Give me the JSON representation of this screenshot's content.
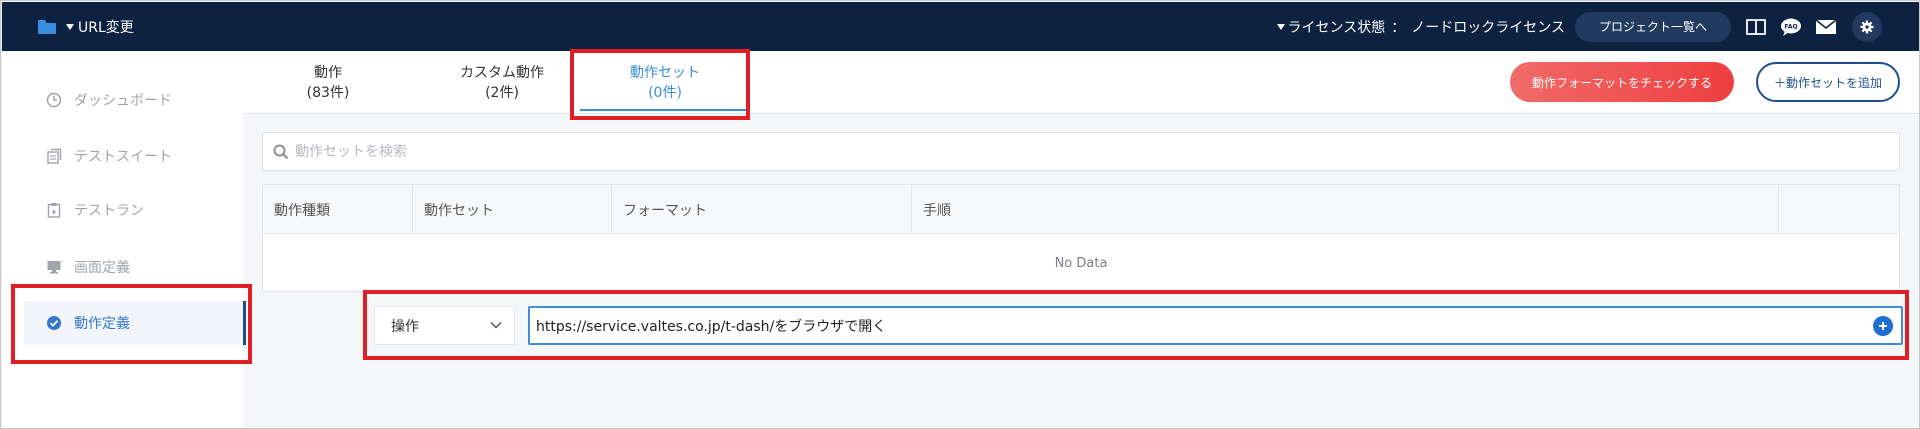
{
  "header": {
    "project_name": "URL変更",
    "license_label": "ライセンス状態",
    "license_sep": "：",
    "license_value": "ノードロックライセンス",
    "project_list_button": "プロジェクト一覧へ",
    "icons": [
      "book-icon",
      "faq-chat-icon",
      "mail-icon",
      "gear-icon"
    ]
  },
  "sidebar": {
    "items": [
      {
        "label": "ダッシュボード",
        "icon": "dashboard-clock-icon"
      },
      {
        "label": "テストスイート",
        "icon": "test-suite-icon"
      },
      {
        "label": "テストラン",
        "icon": "test-run-icon"
      },
      {
        "label": "画面定義",
        "icon": "monitor-icon"
      },
      {
        "label": "動作定義",
        "icon": "check-circle-icon",
        "active": true
      }
    ]
  },
  "tabs": [
    {
      "label": "動作",
      "count": "(83件)"
    },
    {
      "label": "カスタム動作",
      "count": "(2件)"
    },
    {
      "label": "動作セット",
      "count": "(0件)",
      "active": true
    }
  ],
  "actions": {
    "check_format": "動作フォーマットをチェックする",
    "add_action_set": "＋動作セットを追加"
  },
  "search": {
    "placeholder": "動作セットを検索"
  },
  "table": {
    "columns": [
      "動作種類",
      "動作セット",
      "フォーマット",
      "手順",
      ""
    ],
    "empty_text": "No Data"
  },
  "step_row": {
    "operation_value": "操作",
    "step_text": "https://service.valtes.co.jp/t-dash/をブラウザで開く"
  },
  "colors": {
    "topbar": "#0d2140",
    "accent_blue": "#3a8fdc",
    "brand_navy": "#1d4f8e",
    "danger_red": "#ee3f3f",
    "highlight_red": "#e01f25"
  }
}
